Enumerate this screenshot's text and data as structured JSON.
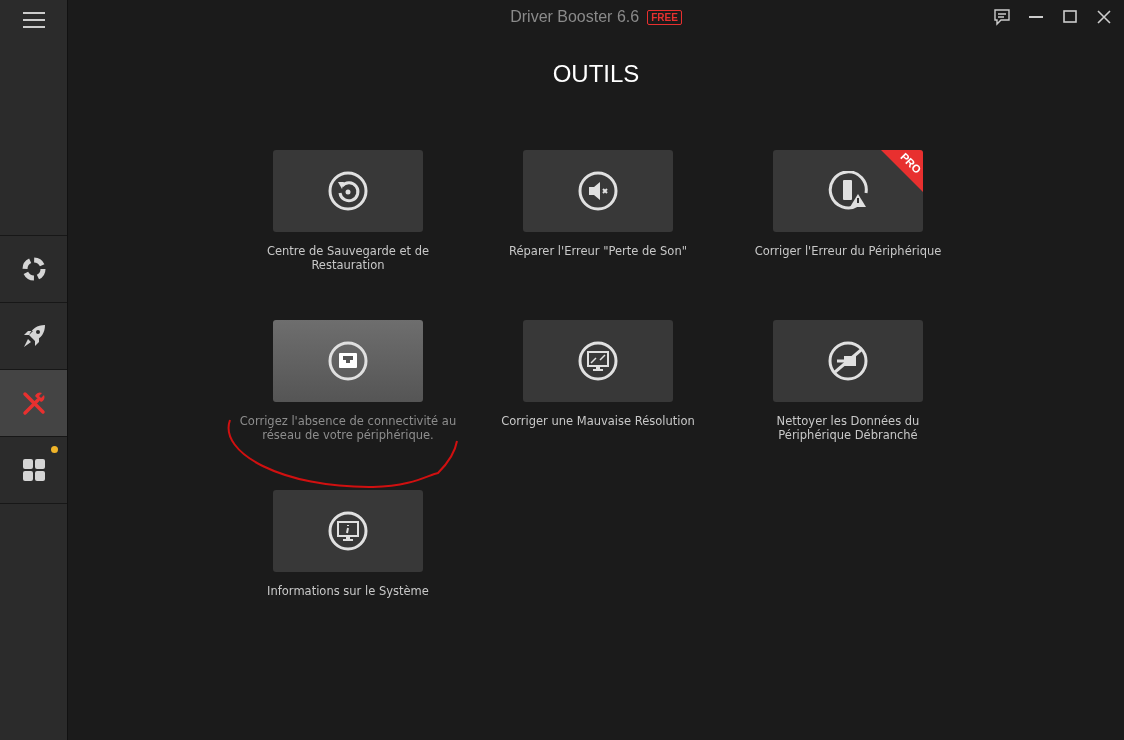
{
  "window": {
    "title": "Driver Booster 6.6",
    "edition_badge": "FREE"
  },
  "sidebar": {
    "items": [
      {
        "selected": false,
        "has_notification": false
      },
      {
        "selected": false,
        "has_notification": false
      },
      {
        "selected": true,
        "has_notification": false
      },
      {
        "selected": false,
        "has_notification": true
      }
    ]
  },
  "page_title": "OUTILS",
  "tools": [
    {
      "label": "Centre de Sauvegarde et de\nRestauration",
      "hovered": false
    },
    {
      "label": "Réparer l'Erreur \"Perte de Son\"",
      "hovered": false
    },
    {
      "label": "Corriger l'Erreur du Périphérique",
      "hovered": false,
      "badge": "PRO"
    },
    {
      "label": "Corrigez l'absence de connectivité au\nréseau de votre périphérique.",
      "hovered": true
    },
    {
      "label": "Corriger une Mauvaise Résolution",
      "hovered": false
    },
    {
      "label": "Nettoyer les Données du\nPériphérique Débranché",
      "hovered": false
    },
    {
      "label": "Informations sur le Système",
      "hovered": false
    }
  ]
}
